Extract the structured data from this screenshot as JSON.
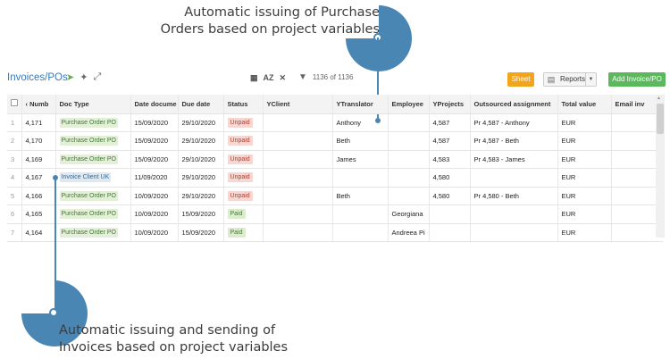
{
  "callouts": {
    "top_line1": "Automatic issuing of Purchase",
    "top_line2": "Orders based on project variables",
    "bottom_line1": "Automatic issuing and sending of",
    "bottom_line2": "Invoices based on project variables",
    "color": "#4a86b4"
  },
  "toolbar": {
    "title": "Invoices/POs",
    "filter_count": "1136 of 1136",
    "sort_label": "AZ",
    "sheet_label": "Sheet",
    "reports_label": "Reports",
    "add_label": "Add Invoice/PO"
  },
  "icons": [
    "share-icon",
    "pin-icon",
    "expand-icon",
    "grid-icon",
    "sort-az-icon",
    "tools-icon",
    "filter-icon",
    "reports-icon",
    "dropdown-caret-icon"
  ],
  "colors": {
    "sheet_button": "#f2a51b",
    "add_button": "#5cb85c",
    "title": "#3a7ab8",
    "unpaid": "#c0392b",
    "paid": "#4a7a3a"
  },
  "grid": {
    "columns": [
      "Numb",
      "Doc Type",
      "Date docume",
      "Due date",
      "Status",
      "YClient",
      "YTranslator",
      "Employee",
      "YProjects",
      "Outsourced assignment",
      "Total value",
      "Email inv"
    ],
    "rows": [
      {
        "idx": "1",
        "num": "4,171",
        "doc": "Purchase Order PO",
        "doc_kind": "po",
        "date": "15/09/2020",
        "due": "29/10/2020",
        "status": "Unpaid",
        "client": "",
        "translator": "Anthony",
        "employee": "",
        "project": "4,587",
        "outsourced": "Pr 4,587 - Anthony",
        "total": "EUR",
        "email": ""
      },
      {
        "idx": "2",
        "num": "4,170",
        "doc": "Purchase Order PO",
        "doc_kind": "po",
        "date": "15/09/2020",
        "due": "29/10/2020",
        "status": "Unpaid",
        "client": "",
        "translator": "Beth",
        "employee": "",
        "project": "4,587",
        "outsourced": "Pr 4,587 - Beth",
        "total": "EUR",
        "email": ""
      },
      {
        "idx": "3",
        "num": "4,169",
        "doc": "Purchase Order PO",
        "doc_kind": "po",
        "date": "15/09/2020",
        "due": "29/10/2020",
        "status": "Unpaid",
        "client": "",
        "translator": "James",
        "employee": "",
        "project": "4,583",
        "outsourced": "Pr 4,583 - James",
        "total": "EUR",
        "email": ""
      },
      {
        "idx": "4",
        "num": "4,167",
        "doc": "Invoice Client UK",
        "doc_kind": "inv",
        "date": "11/09/2020",
        "due": "29/10/2020",
        "status": "Unpaid",
        "client": "",
        "translator": "",
        "employee": "",
        "project": "4,580",
        "outsourced": "",
        "total": "EUR",
        "email": ""
      },
      {
        "idx": "5",
        "num": "4,166",
        "doc": "Purchase Order PO",
        "doc_kind": "po",
        "date": "10/09/2020",
        "due": "29/10/2020",
        "status": "Unpaid",
        "client": "",
        "translator": "Beth",
        "employee": "",
        "project": "4,580",
        "outsourced": "Pr 4,580 - Beth",
        "total": "EUR",
        "email": ""
      },
      {
        "idx": "6",
        "num": "4,165",
        "doc": "Purchase Order PO",
        "doc_kind": "po",
        "date": "10/09/2020",
        "due": "15/09/2020",
        "status": "Paid",
        "client": "",
        "translator": "",
        "employee": "Georgiana",
        "project": "",
        "outsourced": "",
        "total": "EUR",
        "email": ""
      },
      {
        "idx": "7",
        "num": "4,164",
        "doc": "Purchase Order PO",
        "doc_kind": "po",
        "date": "10/09/2020",
        "due": "15/09/2020",
        "status": "Paid",
        "client": "",
        "translator": "",
        "employee": "Andreea Pi",
        "project": "",
        "outsourced": "",
        "total": "EUR",
        "email": ""
      }
    ]
  }
}
